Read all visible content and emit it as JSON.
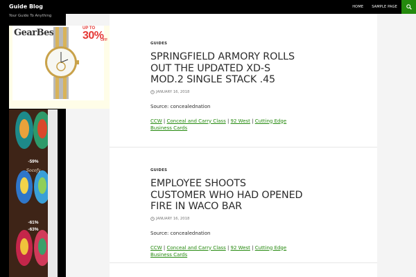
{
  "header": {
    "site_title": "Guide Blog",
    "nav": [
      "Home",
      "Sample Page"
    ]
  },
  "sidebar": {
    "tagline": "Your Guide To Anything",
    "ad_top": {
      "logo": "GearBest",
      "promo_prefix": "UP TO",
      "promo_percent": "30%",
      "promo_suffix": "OFF"
    },
    "ad_bottom": {
      "brand": "Socofy",
      "discounts": [
        "-59%",
        "-61%",
        "-63%"
      ]
    }
  },
  "posts": [
    {
      "category": "Guides",
      "title": "Springfield Armory Rolls Out The Updated XD-S Mod.2 Single Stack .45",
      "date": "January 16, 2018",
      "source": "Source: concealednation",
      "tags": [
        "CCW",
        "Conceal and Carry Class",
        "92 West",
        "Cutting Edge Business Cards"
      ]
    },
    {
      "category": "Guides",
      "title": "Employee Shoots Customer Who Had Opened Fire In Waco Bar",
      "date": "January 16, 2018",
      "source": "Source: concealednation",
      "tags": [
        "CCW",
        "Conceal and Carry Class",
        "92 West",
        "Cutting Edge Business Cards"
      ]
    }
  ],
  "colors": {
    "accent": "#24890d",
    "header_bg": "#000000",
    "text": "#2b2b2b"
  },
  "icons": [
    "search-icon",
    "clock-icon"
  ]
}
